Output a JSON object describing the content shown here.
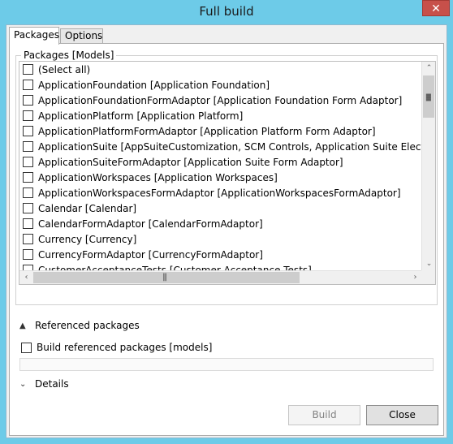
{
  "window": {
    "title": "Full build",
    "close_glyph": "✕"
  },
  "tabs": [
    {
      "label": "Packages",
      "active": true
    },
    {
      "label": "Options",
      "active": false
    }
  ],
  "packages_group": {
    "legend": "Packages [Models]",
    "items": [
      {
        "label": "(Select all)",
        "checked": false
      },
      {
        "label": "ApplicationFoundation [Application Foundation]",
        "checked": false
      },
      {
        "label": "ApplicationFoundationFormAdaptor [Application Foundation Form Adaptor]",
        "checked": false
      },
      {
        "label": "ApplicationPlatform [Application Platform]",
        "checked": false
      },
      {
        "label": "ApplicationPlatformFormAdaptor [Application Platform Form Adaptor]",
        "checked": false
      },
      {
        "label": "ApplicationSuite [AppSuiteCustomization, SCM Controls, Application Suite Electronic Rep",
        "checked": false
      },
      {
        "label": "ApplicationSuiteFormAdaptor [Application Suite Form Adaptor]",
        "checked": false
      },
      {
        "label": "ApplicationWorkspaces [Application Workspaces]",
        "checked": false
      },
      {
        "label": "ApplicationWorkspacesFormAdaptor [ApplicationWorkspacesFormAdaptor]",
        "checked": false
      },
      {
        "label": "Calendar [Calendar]",
        "checked": false
      },
      {
        "label": "CalendarFormAdaptor [CalendarFormAdaptor]",
        "checked": false
      },
      {
        "label": "Currency [Currency]",
        "checked": false
      },
      {
        "label": "CurrencyFormAdaptor [CurrencyFormAdaptor]",
        "checked": false
      },
      {
        "label": "CustomerAcceptanceTests [Customer Acceptance Tests]",
        "checked": false
      }
    ]
  },
  "icons": {
    "scroll_up": "chevron-up-icon",
    "scroll_down": "chevron-down-icon",
    "scroll_left": "chevron-left-icon",
    "scroll_right": "chevron-right-icon",
    "expand_up": "caret-up-icon",
    "expand_down": "caret-down-icon"
  },
  "glyphs": {
    "up": "⌃",
    "down": "⌄",
    "left": "‹",
    "right": "›",
    "expanded": "▲",
    "collapsed": "⌄"
  },
  "referenced": {
    "header": "Referenced packages",
    "checkbox_label": "Build referenced packages [models]",
    "checked": false
  },
  "details": {
    "header": "Details"
  },
  "buttons": {
    "build": "Build",
    "build_enabled": false,
    "close": "Close"
  },
  "colors": {
    "title_bar": "#6dcbe8",
    "close_button": "#c7504a"
  }
}
